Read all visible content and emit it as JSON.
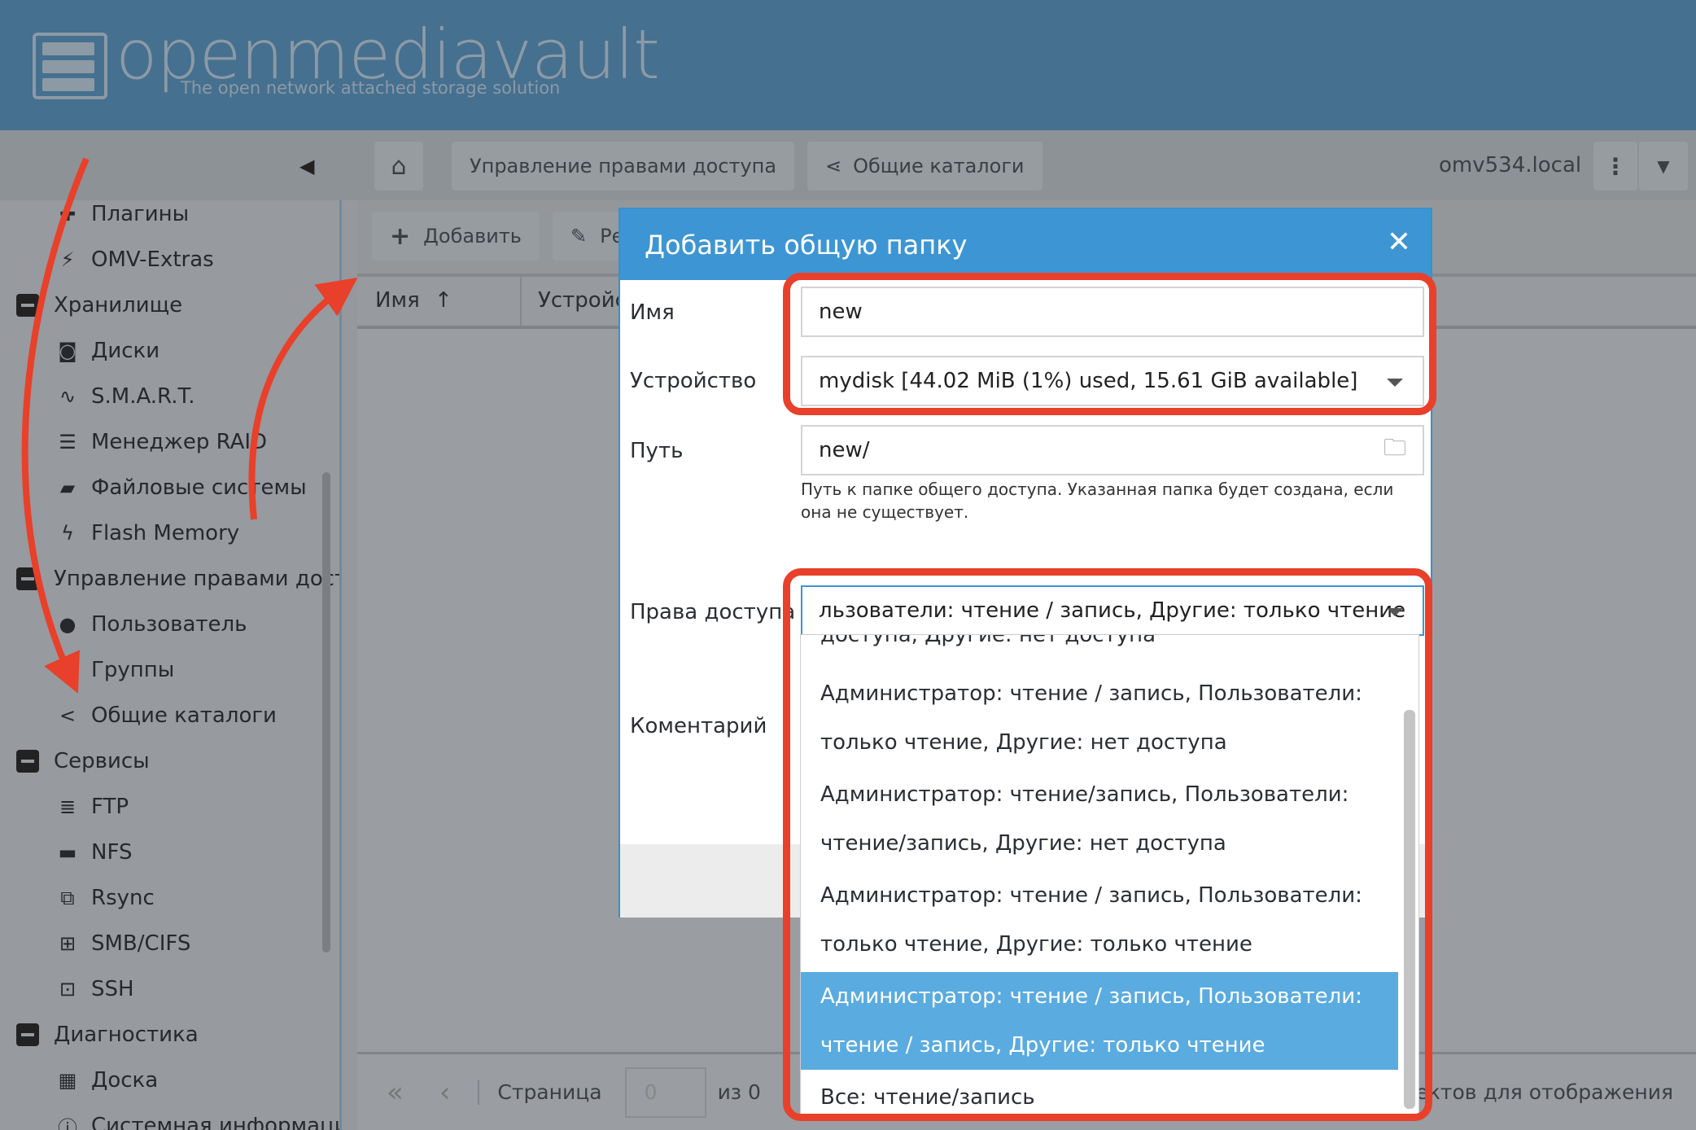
{
  "header": {
    "logo_text": "openmediavault",
    "tagline": "The open network attached storage solution"
  },
  "toolbar": {
    "breadcrumbs": [
      "Управление правами доступа",
      "Общие каталоги"
    ],
    "hostname": "omv534.local"
  },
  "sidebar": {
    "items": [
      {
        "label": "Плагины",
        "icon": "puzzle-icon",
        "type": "item"
      },
      {
        "label": "OMV-Extras",
        "icon": "plug-icon",
        "type": "item"
      },
      {
        "label": "Хранилище",
        "icon": "collapse-icon",
        "type": "group"
      },
      {
        "label": "Диски",
        "icon": "disk-icon",
        "type": "item"
      },
      {
        "label": "S.M.A.R.T.",
        "icon": "heartbeat-icon",
        "type": "item"
      },
      {
        "label": "Менеджер RAID",
        "icon": "database-icon",
        "type": "item"
      },
      {
        "label": "Файловые системы",
        "icon": "folder-icon",
        "type": "item"
      },
      {
        "label": "Flash Memory",
        "icon": "bolt-icon",
        "type": "item"
      },
      {
        "label": "Управление правами доступа",
        "icon": "collapse-icon",
        "type": "group"
      },
      {
        "label": "Пользователь",
        "icon": "user-icon",
        "type": "item"
      },
      {
        "label": "Группы",
        "icon": "users-icon",
        "type": "item"
      },
      {
        "label": "Общие каталоги",
        "icon": "share-icon",
        "type": "item"
      },
      {
        "label": "Сервисы",
        "icon": "collapse-icon",
        "type": "group"
      },
      {
        "label": "FTP",
        "icon": "server-icon",
        "type": "item"
      },
      {
        "label": "NFS",
        "icon": "desktop-icon",
        "type": "item"
      },
      {
        "label": "Rsync",
        "icon": "sitemap-icon",
        "type": "item"
      },
      {
        "label": "SMB/CIFS",
        "icon": "windows-icon",
        "type": "item"
      },
      {
        "label": "SSH",
        "icon": "terminal-icon",
        "type": "item"
      },
      {
        "label": "Диагностика",
        "icon": "collapse-icon",
        "type": "group"
      },
      {
        "label": "Доска",
        "icon": "dashboard-icon",
        "type": "item"
      },
      {
        "label": "Системная информация",
        "icon": "info-icon",
        "type": "item"
      }
    ]
  },
  "grid": {
    "add_label": "Добавить",
    "edit_label": "Ре",
    "columns": [
      "Имя",
      "Устройство"
    ],
    "pager": {
      "page_label": "Страница",
      "page_value": "0",
      "of_label": "из 0",
      "empty_text": "Нет объектов для отображения"
    }
  },
  "modal": {
    "title": "Добавить общую папку",
    "name_label": "Имя",
    "name_value": "new",
    "device_label": "Устройство",
    "device_value": "mydisk [44.02 MiB (1%) used, 15.61 GiB available]",
    "path_label": "Путь",
    "path_value": "new/",
    "path_hint": "Путь к папке общего доступа. Указанная папка будет создана, если она не существует.",
    "perm_label": "Права доступа",
    "perm_value": "льзователи: чтение / запись, Другие: только чтение",
    "comment_label": "Коментарий",
    "options": [
      "доступа, Другие: нет доступа",
      "Администратор: чтение / запись, Пользователи:",
      "только чтение, Другие: нет доступа",
      "Администратор: чтение/запись, Пользователи:",
      "чтение/запись, Другие: нет доступа",
      "Администратор: чтение / запись, Пользователи:",
      "только чтение, Другие: только чтение",
      "Администратор: чтение / запись, Пользователи:",
      "чтение / запись, Другие: только чтение",
      "Все: чтение/запись"
    ]
  },
  "colors": {
    "accent": "#3d96d3",
    "selected": "#5aabdf",
    "annotation": "#e8402a"
  }
}
